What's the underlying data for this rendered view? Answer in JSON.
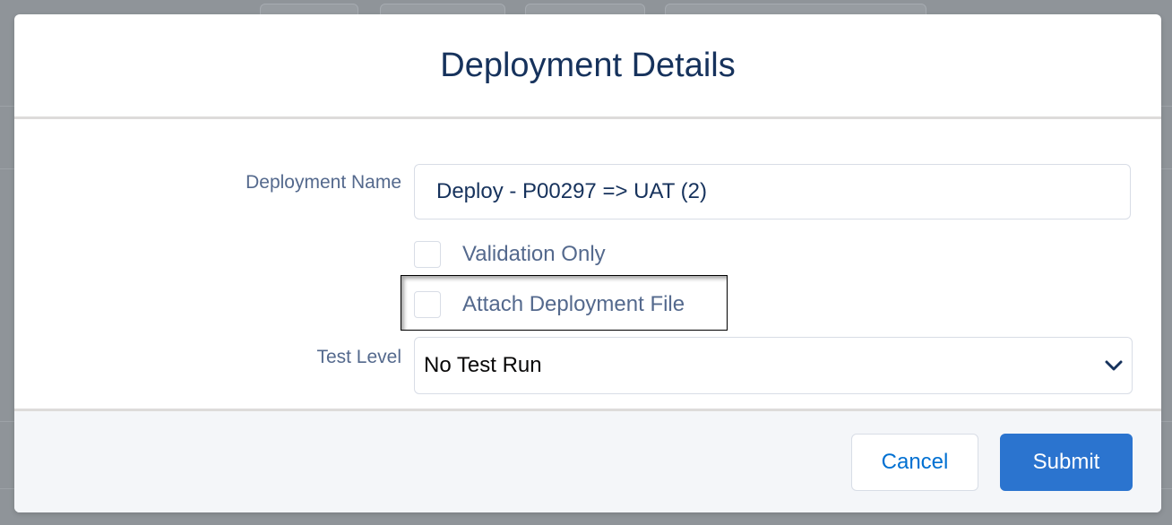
{
  "modal": {
    "title": "Deployment Details"
  },
  "form": {
    "deployment_name": {
      "label": "Deployment Name",
      "value": "Deploy - P00297 => UAT (2)"
    },
    "validation_only": {
      "label": "Validation Only",
      "checked": false
    },
    "attach_file": {
      "label": "Attach Deployment File",
      "checked": false
    },
    "test_level": {
      "label": "Test Level",
      "selected": "No Test Run"
    }
  },
  "footer": {
    "cancel_label": "Cancel",
    "submit_label": "Submit"
  },
  "colors": {
    "title": "#16325c",
    "label": "#54698d",
    "brand": "#2b74cf",
    "overlay": "#8f9499"
  },
  "icons": {
    "select_chevron": "chevron-down-icon"
  }
}
